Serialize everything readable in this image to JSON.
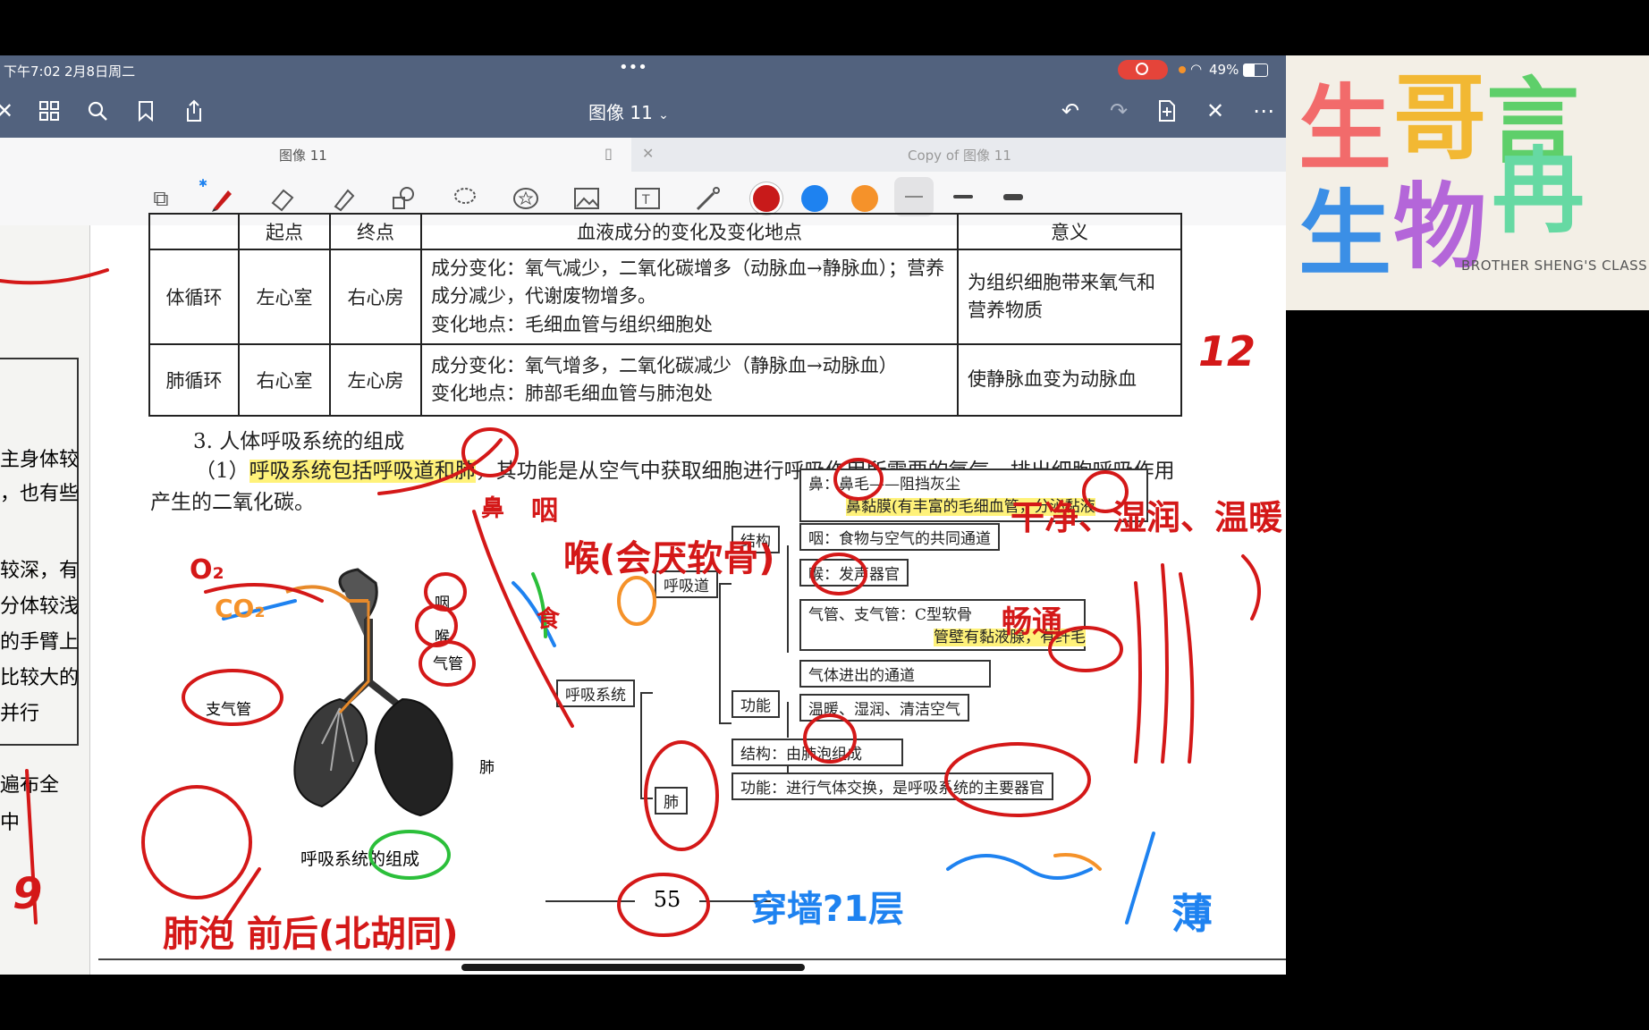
{
  "status": {
    "time": "下午7:02",
    "date": "2月8日周二",
    "dots": "•••",
    "battery": "49%"
  },
  "nav": {
    "title": "图像 11",
    "title_caret": "⌄"
  },
  "tabs": [
    {
      "label": "图像 11"
    },
    {
      "label": "Copy of 图像 11"
    }
  ],
  "toolbar": {
    "colors": [
      "#c81a1a",
      "#1e82f0",
      "#f5922a"
    ]
  },
  "table": {
    "headers": [
      "起点",
      "终点",
      "血液成分的变化及变化地点",
      "意义"
    ],
    "rows": [
      {
        "name": "体循环",
        "start": "左心室",
        "end": "右心房",
        "change1": "成分变化：氧气减少，二氧化碳增多（动脉血→静脉血）；营养成分减少，代谢废物增多。",
        "change2": "变化地点：毛细血管与组织细胞处",
        "meaning": "为组织细胞带来氧气和营养物质"
      },
      {
        "name": "肺循环",
        "start": "右心室",
        "end": "左心房",
        "change1": "成分变化：氧气增多，二氧化碳减少（静脉血→动脉血）",
        "change2": "变化地点：肺部毛细血管与肺泡处",
        "meaning": "使静脉血变为动脉血"
      }
    ]
  },
  "section": {
    "heading": "3. 人体呼吸系统的组成",
    "p_prefix": "（1）",
    "p_highlight": "呼吸系统包括呼吸道和肺",
    "p_rest": "，其功能是从空气中获取细胞进行呼吸作用所需要的氧气，排出细胞呼吸作用产生的二氧化碳。"
  },
  "left_column": [
    "主身体较",
    "，也有些",
    "较深，有",
    "分体较浅",
    "的手臂上",
    "比较大的",
    "并行",
    "遍布全",
    "中"
  ],
  "figure": {
    "labels": {
      "yan": "咽",
      "hou": "喉",
      "qiguan": "气管",
      "zhiqiguan": "支气管",
      "fei": "肺"
    },
    "caption": "呼吸系统的组成"
  },
  "tree": {
    "root": "呼吸系统",
    "airway": "呼吸道",
    "lung": "肺",
    "structure": "结构",
    "function": "功能",
    "nose_a": "鼻：鼻毛——阻挡灰尘",
    "nose_b": "鼻黏膜(有丰富的毛细血管，分泌黏液",
    "pharynx": "咽：食物与空气的共同通道",
    "larynx": "喉：发声器官",
    "trachea_a": "气管、支气管：C型软骨",
    "trachea_b": "管壁有黏液腺，有纤毛",
    "func_a": "气体进出的通道",
    "func_b": "温暖、湿润、清洁空气",
    "lung_struct": "结构：由肺泡组成",
    "lung_func": "功能：进行气体交换，是呼吸系统的主要器官"
  },
  "page_number": "55",
  "handwriting": {
    "clean": "干净、湿润、温暖",
    "hou_note": "喉(会厌软骨)",
    "yan_note": "咽",
    "bi": "鼻",
    "shi": "食",
    "chang": "畅通",
    "twelve": "12",
    "o2": "O₂",
    "co2": "CO₂",
    "bottom": "肺泡 前后(北胡同)",
    "wall": "穿墙?1层",
    "thin": "薄",
    "nine": "9"
  },
  "logo": {
    "chars": [
      "生",
      "哥",
      "言",
      "生",
      "物",
      "冉"
    ],
    "sub": "BROTHER SHENG'S CLASS"
  }
}
